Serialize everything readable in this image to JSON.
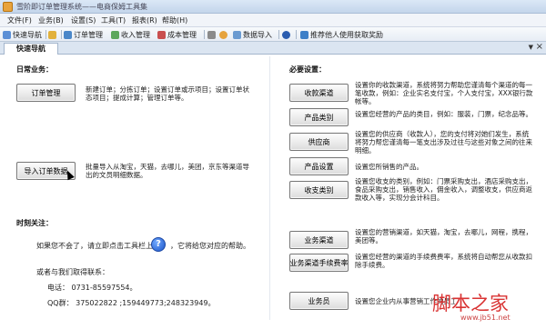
{
  "window": {
    "title": "雪阶即订单管理系统——电商保姆工具集"
  },
  "menu": [
    "文件(F)",
    "业务(B)",
    "设置(S)",
    "工具(T)",
    "报表(R)",
    "帮助(H)"
  ],
  "toolbar": [
    "快速导航",
    "",
    "订单管理",
    "收入管理",
    "成本管理",
    "",
    "",
    "数据导入",
    "",
    "推荐他人使用获取奖励"
  ],
  "tab": {
    "label": "快速导航",
    "dropdown": "▼",
    "close": "×"
  },
  "left": {
    "daily_title": "日常业务：",
    "order_btn": "订单管理",
    "order_desc": "新建订单；分拣订单；设置订单或示项目；设置订单状态项目；提成计算；管理订单等。",
    "import_btn": "导入订单数据",
    "import_desc": "批量导入从淘宝，天猫，去哪儿，美团，京东等渠道导出的文员明细数据。",
    "focus_title": "时刻关注：",
    "help_text_1": "如果您不会了，请立即点击工具栏上的",
    "help_icon": "?",
    "help_text_2": "，它将给您对应的帮助。",
    "contact_title": "或者与我们取得联系：",
    "phone": "电话：  0731-85597554。",
    "qq": "QQ群：  375022822 ;159449773;248323949。"
  },
  "right": {
    "required_title": "必要设置：",
    "items": [
      {
        "btn": "收款渠道",
        "desc": "设置你的收款渠道，系统将努力帮助您谨清每个渠道的每一笔收款，例如：企业实名支付宝，个人支付宝，XXX银行款帐等。"
      },
      {
        "btn": "产品类别",
        "desc": "设置您经营的产品的类目，例如：服装，门票，纪念品等。"
      },
      {
        "btn": "供应商",
        "desc": "设置您的供应商（收款人），您的支付将对她们发生，系统将努力帮您谨清每一笔支出涉及过往与这些对象之间的往来明细。"
      },
      {
        "btn": "产品设置",
        "desc": "设置您所销售的产品。"
      },
      {
        "btn": "收支类别",
        "desc": "设置您收支的类别，例如：门票采购支出，酒店采购支出，食品采购支出，销售收入，佣金收入，调整收支，供应商返款收入等，实现分会计科目。"
      },
      {
        "btn": "业务渠道",
        "desc": "设置您的营销渠道，如天猫，淘宝，去哪儿，网程，携程，美团等。"
      },
      {
        "btn": "业务渠道手续费率",
        "desc": "设置您经营的渠道的手续费费率，系统将自动帮您从收款扣除手续费。"
      },
      {
        "btn": "业务员",
        "desc": "设置您企业内从事营销工作的员工。"
      }
    ]
  },
  "watermark": {
    "main": "脚本之家",
    "url": "www.jb51.net"
  },
  "colors": {
    "accent": "#2a5db0",
    "chrome": "#c6d6ea",
    "watermark": "#d93333"
  }
}
